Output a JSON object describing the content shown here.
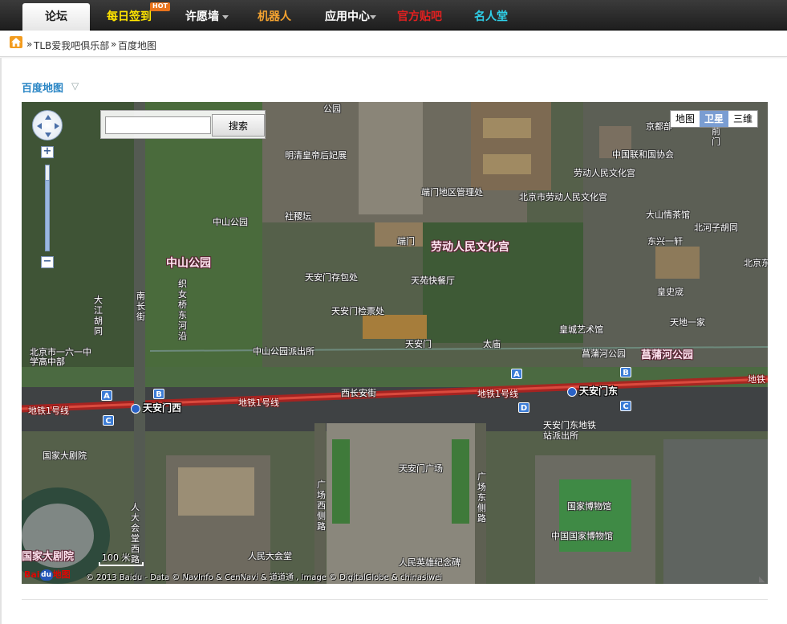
{
  "nav": {
    "items": [
      {
        "label": "论坛",
        "color": "#222222"
      },
      {
        "label": "每日签到",
        "color": "#ffe400",
        "badge": "HOT"
      },
      {
        "label": "许愿墙",
        "color": "#ffffff"
      },
      {
        "label": "机器人",
        "color": "#f3a230"
      },
      {
        "label": "应用中心",
        "color": "#ffffff"
      },
      {
        "label": "官方贴吧",
        "color": "#e02020"
      },
      {
        "label": "名人堂",
        "color": "#2fd0e8"
      }
    ]
  },
  "breadcrumb": {
    "sep": "»",
    "club": "TLB爱我吧俱乐部",
    "page": "百度地图"
  },
  "section": {
    "title": "百度地图",
    "toggle": "▽"
  },
  "map": {
    "search_placeholder": "",
    "search_button": "搜索",
    "zoom_in": "+",
    "zoom_out": "−",
    "types": [
      "地图",
      "卫星",
      "三维"
    ],
    "active_type": "卫星",
    "scale": "100 米",
    "copyright": "© 2013 Baidu - Data © NavInfo & CenNavi & 道道通 , Image © DigitalGlobe & chinasiwei",
    "logo_bai": "Bai",
    "logo_paw": "du",
    "logo_map": "地图",
    "labels": {
      "park_top": "公园",
      "tomb": "明清皇帝后妃展",
      "jingdu": "京都部",
      "unionlink": "中国联和国协会",
      "zs_park_small": "中山公园",
      "sheji": "社稷坛",
      "duanmen_office": "端门地区管理处",
      "labor_small": "北京市劳动人民文化宫",
      "labor_club": "劳动人民文化宫",
      "taimiao_dist": "劳动人民文化宫",
      "dashan": "大山情茶馆",
      "beihe": "北河子胡同",
      "dongxing": "东兴一轩",
      "duanmen": "端门",
      "tiananmen_store": "天安门存包处",
      "tianyuan": "天苑快餐厅",
      "huangshi": "皇史宬",
      "zs_park": "中山公园",
      "labor_palace": "劳动人民文化宫",
      "tiananmen_ticket": "天安门检票处",
      "tiandi": "天地一家",
      "beijing_right": "北京东",
      "zhijiao": "织女桥东河沿",
      "nanchang": "南长街",
      "dajiang": "大江胡同",
      "beijing_school": "北京市一六一中学高中部",
      "huangjia": "皇城艺术馆",
      "zs_police": "中山公园派出所",
      "tiananmen": "天安门",
      "taimiao": "太庙",
      "changpu_small": "菖蒲河公园",
      "changpu": "菖蒲河公园",
      "line1_left": "地铁1号线",
      "line1_mid": "地铁1号线",
      "line1_right": "地铁1号线",
      "line1_far": "地铁",
      "xichang": "西长安街",
      "station_west": "天安门西",
      "station_east": "天安门东",
      "police_east": "天安门东地铁站派出所",
      "grand_theater_small": "国家大剧院",
      "square": "天安门广场",
      "xi_road": "广场西侧路",
      "dong_road": "广场东侧路",
      "museum": "国家博物馆",
      "museum2": "中国国家博物馆",
      "people_west": "人大会堂西路",
      "grand_theater": "国家大剧院",
      "people_hall": "人民大会堂",
      "monument": "人民英雄纪念碑",
      "qianmen": "前门"
    }
  }
}
